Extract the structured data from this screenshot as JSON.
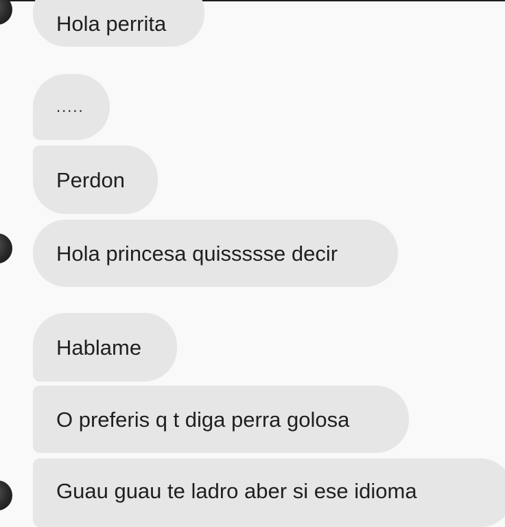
{
  "chat": {
    "messages": [
      {
        "text": "Hola perrita"
      },
      {
        "text": "....."
      },
      {
        "text": "Perdon"
      },
      {
        "text": "Hola princesa quissssse decir"
      },
      {
        "text": "Hablame"
      },
      {
        "text": "O preferis q t diga perra golosa"
      },
      {
        "text": "Guau guau te ladro aber si ese idioma"
      }
    ]
  }
}
